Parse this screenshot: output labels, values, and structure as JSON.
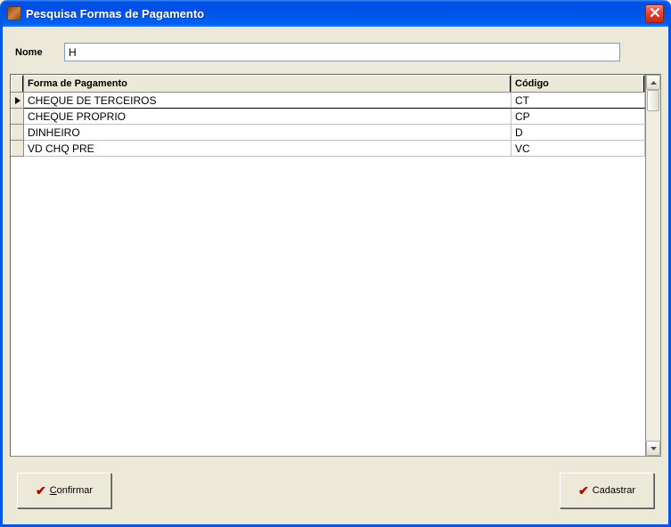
{
  "window": {
    "title": "Pesquisa Formas de Pagamento"
  },
  "search": {
    "label": "Nome",
    "value": "H"
  },
  "grid": {
    "columns": {
      "name": "Forma de Pagamento",
      "code": "Código"
    },
    "rows": [
      {
        "current": true,
        "name": "CHEQUE DE TERCEIROS",
        "code": "CT"
      },
      {
        "current": false,
        "name": "CHEQUE PROPRIO",
        "code": "CP"
      },
      {
        "current": false,
        "name": "DINHEIRO",
        "code": "D"
      },
      {
        "current": false,
        "name": "VD CHQ PRE",
        "code": "VC"
      }
    ]
  },
  "buttons": {
    "confirm": "Confirmar",
    "register": "Cadastrar"
  }
}
